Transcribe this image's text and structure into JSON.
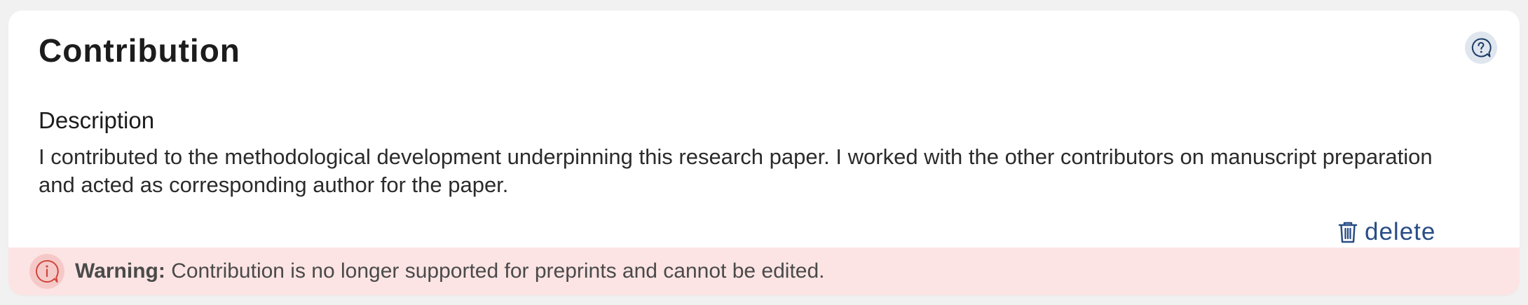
{
  "card": {
    "title": "Contribution",
    "help_icon": "help-chat-icon"
  },
  "description": {
    "heading": "Description",
    "text": "I contributed to the methodological development underpinning this research paper. I worked with the other contributors on manuscript preparation and acted as corresponding author for the paper."
  },
  "actions": {
    "delete_label": "delete",
    "delete_icon": "trash-icon"
  },
  "warning": {
    "icon": "info-alert-icon",
    "label": "Warning:",
    "message": " Contribution is no longer supported for preprints and cannot be edited."
  },
  "colors": {
    "link": "#2a4d86",
    "warning_bg": "#fde4e4",
    "warning_icon": "#d0453a"
  }
}
